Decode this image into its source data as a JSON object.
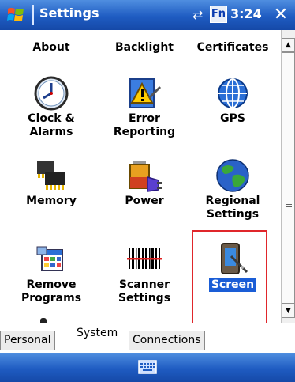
{
  "titlebar": {
    "title": "Settings",
    "time": "3:24",
    "fn_label": "Fn",
    "connectivity_icon": "connectivity-icon",
    "close_label": "✕"
  },
  "items": [
    {
      "label": "About",
      "icon": "about-icon"
    },
    {
      "label": "Backlight",
      "icon": "backlight-icon"
    },
    {
      "label": "Certificates",
      "icon": "certificates-icon"
    },
    {
      "label": "Clock &\nAlarms",
      "icon": "clock-icon"
    },
    {
      "label": "Error\nReporting",
      "icon": "error-reporting-icon"
    },
    {
      "label": "GPS",
      "icon": "gps-globe-icon"
    },
    {
      "label": "Memory",
      "icon": "memory-chip-icon"
    },
    {
      "label": "Power",
      "icon": "battery-plug-icon"
    },
    {
      "label": "Regional\nSettings",
      "icon": "globe-icon"
    },
    {
      "label": "Remove\nPrograms",
      "icon": "remove-programs-icon"
    },
    {
      "label": "Scanner\nSettings",
      "icon": "barcode-icon"
    },
    {
      "label": "Screen",
      "icon": "screen-stylus-icon",
      "selected": true
    }
  ],
  "tabs": [
    {
      "label": "Personal",
      "active": false
    },
    {
      "label": "System",
      "active": true
    },
    {
      "label": "Connections",
      "active": false
    }
  ],
  "bottombar": {
    "keyboard_icon": "keyboard-icon"
  },
  "colors": {
    "titlebar": "#1f5cc2",
    "selection": "#1a5dd6",
    "highlight_frame": "#e0262b"
  }
}
